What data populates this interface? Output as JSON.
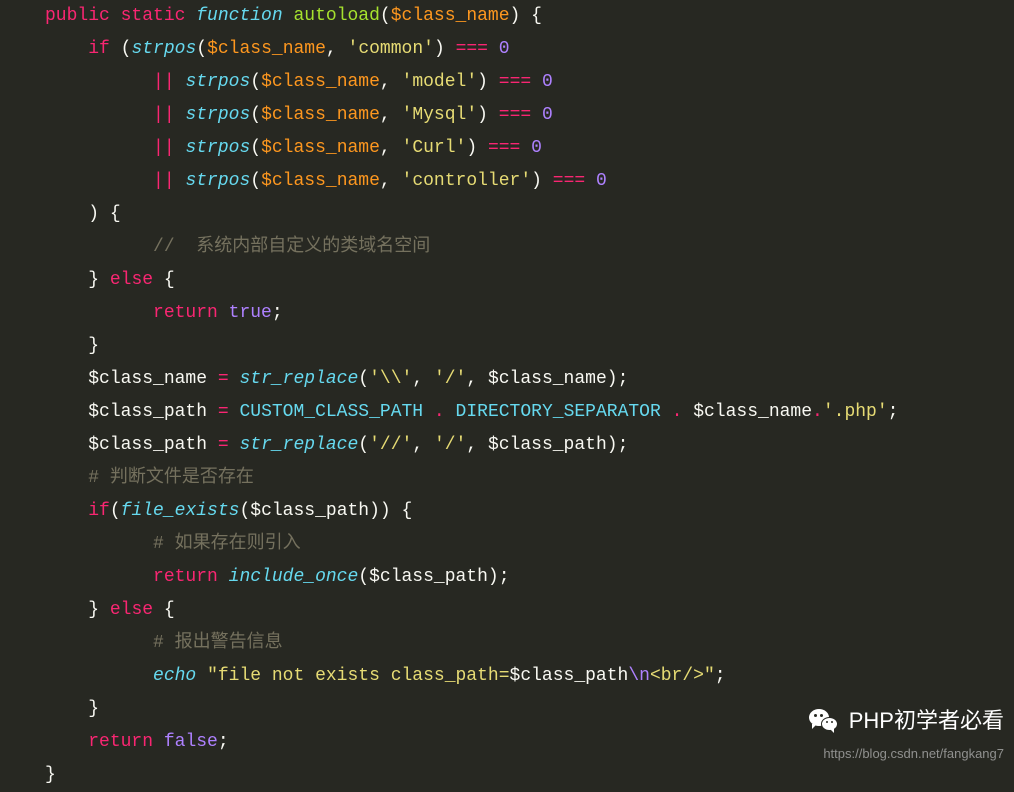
{
  "lines": [
    {
      "indent": 0,
      "tokens": [
        {
          "cls": "kw-red",
          "t": "public"
        },
        {
          "cls": "",
          "t": " "
        },
        {
          "cls": "kw-red",
          "t": "static"
        },
        {
          "cls": "",
          "t": " "
        },
        {
          "cls": "kw-italic",
          "t": "function"
        },
        {
          "cls": "",
          "t": " "
        },
        {
          "cls": "fn-green",
          "t": "autoload"
        },
        {
          "cls": "paren",
          "t": "("
        },
        {
          "cls": "var",
          "t": "$class_name"
        },
        {
          "cls": "paren",
          "t": ")"
        },
        {
          "cls": "",
          "t": " "
        },
        {
          "cls": "brace",
          "t": "{"
        }
      ]
    },
    {
      "indent": 1,
      "tokens": [
        {
          "cls": "kw-red",
          "t": "if"
        },
        {
          "cls": "",
          "t": " "
        },
        {
          "cls": "paren",
          "t": "("
        },
        {
          "cls": "kw-italic",
          "t": "strpos"
        },
        {
          "cls": "paren",
          "t": "("
        },
        {
          "cls": "var",
          "t": "$class_name"
        },
        {
          "cls": "",
          "t": ", "
        },
        {
          "cls": "str",
          "t": "'common'"
        },
        {
          "cls": "paren",
          "t": ")"
        },
        {
          "cls": "",
          "t": " "
        },
        {
          "cls": "op-red",
          "t": "==="
        },
        {
          "cls": "",
          "t": " "
        },
        {
          "cls": "num",
          "t": "0"
        }
      ]
    },
    {
      "indent": 2.5,
      "tokens": [
        {
          "cls": "op-red",
          "t": "||"
        },
        {
          "cls": "",
          "t": " "
        },
        {
          "cls": "kw-italic",
          "t": "strpos"
        },
        {
          "cls": "paren",
          "t": "("
        },
        {
          "cls": "var",
          "t": "$class_name"
        },
        {
          "cls": "",
          "t": ", "
        },
        {
          "cls": "str",
          "t": "'model'"
        },
        {
          "cls": "paren",
          "t": ")"
        },
        {
          "cls": "",
          "t": " "
        },
        {
          "cls": "op-red",
          "t": "==="
        },
        {
          "cls": "",
          "t": " "
        },
        {
          "cls": "num",
          "t": "0"
        }
      ]
    },
    {
      "indent": 2.5,
      "tokens": [
        {
          "cls": "op-red",
          "t": "||"
        },
        {
          "cls": "",
          "t": " "
        },
        {
          "cls": "kw-italic",
          "t": "strpos"
        },
        {
          "cls": "paren",
          "t": "("
        },
        {
          "cls": "var",
          "t": "$class_name"
        },
        {
          "cls": "",
          "t": ", "
        },
        {
          "cls": "str",
          "t": "'Mysql'"
        },
        {
          "cls": "paren",
          "t": ")"
        },
        {
          "cls": "",
          "t": " "
        },
        {
          "cls": "op-red",
          "t": "==="
        },
        {
          "cls": "",
          "t": " "
        },
        {
          "cls": "num",
          "t": "0"
        }
      ]
    },
    {
      "indent": 2.5,
      "tokens": [
        {
          "cls": "op-red",
          "t": "||"
        },
        {
          "cls": "",
          "t": " "
        },
        {
          "cls": "kw-italic",
          "t": "strpos"
        },
        {
          "cls": "paren",
          "t": "("
        },
        {
          "cls": "var",
          "t": "$class_name"
        },
        {
          "cls": "",
          "t": ", "
        },
        {
          "cls": "str",
          "t": "'Curl'"
        },
        {
          "cls": "paren",
          "t": ")"
        },
        {
          "cls": "",
          "t": " "
        },
        {
          "cls": "op-red",
          "t": "==="
        },
        {
          "cls": "",
          "t": " "
        },
        {
          "cls": "num",
          "t": "0"
        }
      ]
    },
    {
      "indent": 2.5,
      "tokens": [
        {
          "cls": "op-red",
          "t": "||"
        },
        {
          "cls": "",
          "t": " "
        },
        {
          "cls": "kw-italic",
          "t": "strpos"
        },
        {
          "cls": "paren",
          "t": "("
        },
        {
          "cls": "var",
          "t": "$class_name"
        },
        {
          "cls": "",
          "t": ", "
        },
        {
          "cls": "str",
          "t": "'controller'"
        },
        {
          "cls": "paren",
          "t": ")"
        },
        {
          "cls": "",
          "t": " "
        },
        {
          "cls": "op-red",
          "t": "==="
        },
        {
          "cls": "",
          "t": " "
        },
        {
          "cls": "num",
          "t": "0"
        }
      ]
    },
    {
      "indent": 1,
      "tokens": [
        {
          "cls": "paren",
          "t": ")"
        },
        {
          "cls": "",
          "t": " "
        },
        {
          "cls": "brace",
          "t": "{"
        }
      ]
    },
    {
      "indent": 2.5,
      "tokens": [
        {
          "cls": "comment",
          "t": "//  系统内部自定义的类域名空间"
        }
      ]
    },
    {
      "indent": 1,
      "tokens": [
        {
          "cls": "brace",
          "t": "}"
        },
        {
          "cls": "",
          "t": " "
        },
        {
          "cls": "kw-red",
          "t": "else"
        },
        {
          "cls": "",
          "t": " "
        },
        {
          "cls": "brace",
          "t": "{"
        }
      ]
    },
    {
      "indent": 2.5,
      "tokens": [
        {
          "cls": "kw-red",
          "t": "return"
        },
        {
          "cls": "",
          "t": " "
        },
        {
          "cls": "const-purple",
          "t": "true"
        },
        {
          "cls": "semi",
          "t": ";"
        }
      ]
    },
    {
      "indent": 1,
      "tokens": [
        {
          "cls": "brace",
          "t": "}"
        }
      ]
    },
    {
      "indent": 1,
      "tokens": [
        {
          "cls": "",
          "t": "$class_name "
        },
        {
          "cls": "op-red",
          "t": "="
        },
        {
          "cls": "",
          "t": " "
        },
        {
          "cls": "kw-italic",
          "t": "str_replace"
        },
        {
          "cls": "paren",
          "t": "("
        },
        {
          "cls": "str",
          "t": "'\\\\'"
        },
        {
          "cls": "",
          "t": ", "
        },
        {
          "cls": "str",
          "t": "'/'"
        },
        {
          "cls": "",
          "t": ", $class_name"
        },
        {
          "cls": "paren",
          "t": ")"
        },
        {
          "cls": "semi",
          "t": ";"
        }
      ]
    },
    {
      "indent": 1,
      "tokens": [
        {
          "cls": "",
          "t": "$class_path "
        },
        {
          "cls": "op-red",
          "t": "="
        },
        {
          "cls": "",
          "t": " "
        },
        {
          "cls": "const-blue",
          "t": "CUSTOM_CLASS_PATH"
        },
        {
          "cls": "",
          "t": " "
        },
        {
          "cls": "dot",
          "t": "."
        },
        {
          "cls": "",
          "t": " "
        },
        {
          "cls": "const-blue",
          "t": "DIRECTORY_SEPARATOR"
        },
        {
          "cls": "",
          "t": " "
        },
        {
          "cls": "dot",
          "t": "."
        },
        {
          "cls": "",
          "t": " $class_name"
        },
        {
          "cls": "dot",
          "t": "."
        },
        {
          "cls": "str",
          "t": "'.php'"
        },
        {
          "cls": "semi",
          "t": ";"
        }
      ]
    },
    {
      "indent": 1,
      "tokens": [
        {
          "cls": "",
          "t": "$class_path "
        },
        {
          "cls": "op-red",
          "t": "="
        },
        {
          "cls": "",
          "t": " "
        },
        {
          "cls": "kw-italic",
          "t": "str_replace"
        },
        {
          "cls": "paren",
          "t": "("
        },
        {
          "cls": "str",
          "t": "'//'"
        },
        {
          "cls": "",
          "t": ", "
        },
        {
          "cls": "str",
          "t": "'/'"
        },
        {
          "cls": "",
          "t": ", $class_path"
        },
        {
          "cls": "paren",
          "t": ")"
        },
        {
          "cls": "semi",
          "t": ";"
        }
      ]
    },
    {
      "indent": 1,
      "tokens": [
        {
          "cls": "comment",
          "t": "# 判断文件是否存在"
        }
      ]
    },
    {
      "indent": 1,
      "tokens": [
        {
          "cls": "kw-red",
          "t": "if"
        },
        {
          "cls": "paren",
          "t": "("
        },
        {
          "cls": "kw-italic",
          "t": "file_exists"
        },
        {
          "cls": "paren",
          "t": "("
        },
        {
          "cls": "",
          "t": "$class_path"
        },
        {
          "cls": "paren",
          "t": "))"
        },
        {
          "cls": "",
          "t": " "
        },
        {
          "cls": "brace",
          "t": "{"
        }
      ]
    },
    {
      "indent": 2.5,
      "tokens": [
        {
          "cls": "comment",
          "t": "# 如果存在则引入"
        }
      ]
    },
    {
      "indent": 2.5,
      "tokens": [
        {
          "cls": "kw-red",
          "t": "return"
        },
        {
          "cls": "",
          "t": " "
        },
        {
          "cls": "kw-italic",
          "t": "include_once"
        },
        {
          "cls": "paren",
          "t": "("
        },
        {
          "cls": "",
          "t": "$class_path"
        },
        {
          "cls": "paren",
          "t": ")"
        },
        {
          "cls": "semi",
          "t": ";"
        }
      ]
    },
    {
      "indent": 1,
      "tokens": [
        {
          "cls": "brace",
          "t": "}"
        },
        {
          "cls": "",
          "t": " "
        },
        {
          "cls": "kw-red",
          "t": "else"
        },
        {
          "cls": "",
          "t": " "
        },
        {
          "cls": "brace",
          "t": "{"
        }
      ]
    },
    {
      "indent": 2.5,
      "tokens": [
        {
          "cls": "comment",
          "t": "# 报出警告信息"
        }
      ]
    },
    {
      "indent": 2.5,
      "tokens": [
        {
          "cls": "kw-italic",
          "t": "echo"
        },
        {
          "cls": "",
          "t": " "
        },
        {
          "cls": "str",
          "t": "\"file not exists class_path="
        },
        {
          "cls": "",
          "t": "$class_path"
        },
        {
          "cls": "const-purple",
          "t": "\\n"
        },
        {
          "cls": "str",
          "t": "<br/>\""
        },
        {
          "cls": "semi",
          "t": ";"
        }
      ]
    },
    {
      "indent": 1,
      "tokens": [
        {
          "cls": "brace",
          "t": "}"
        }
      ]
    },
    {
      "indent": 1,
      "tokens": [
        {
          "cls": "kw-red",
          "t": "return"
        },
        {
          "cls": "",
          "t": " "
        },
        {
          "cls": "const-purple",
          "t": "false"
        },
        {
          "cls": "semi",
          "t": ";"
        }
      ]
    },
    {
      "indent": 0,
      "tokens": [
        {
          "cls": "brace",
          "t": "}"
        }
      ]
    }
  ],
  "watermark": {
    "title": "PHP初学者必看",
    "url": "https://blog.csdn.net/fangkang7"
  }
}
